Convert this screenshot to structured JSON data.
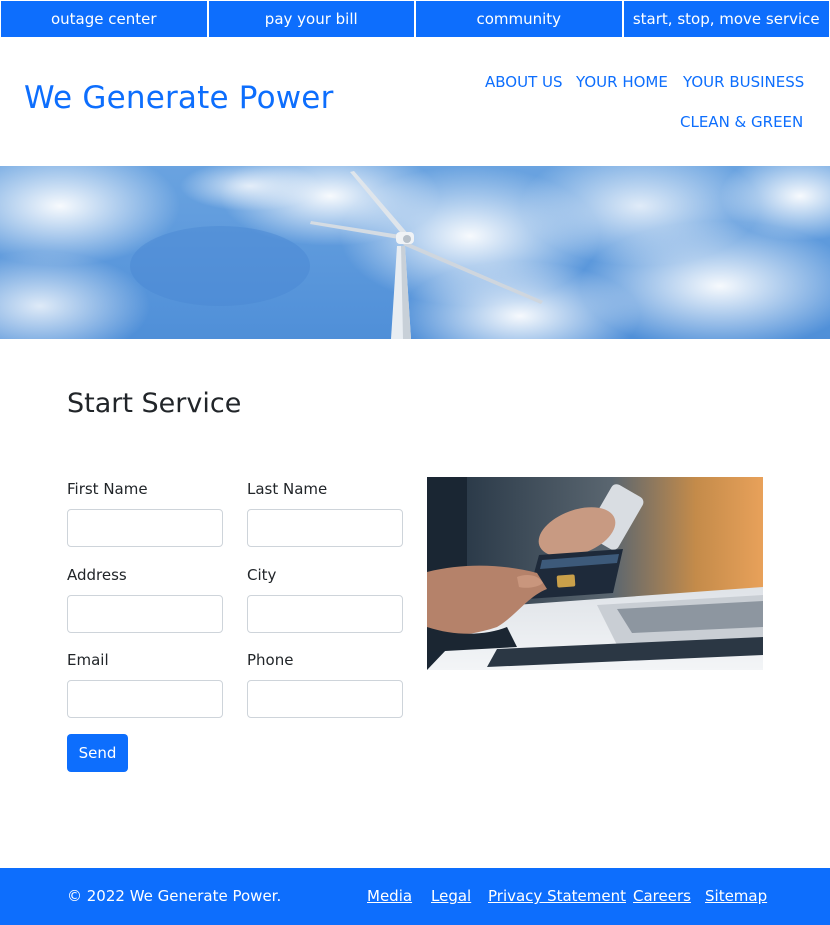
{
  "topbar": {
    "items": [
      {
        "label": "outage center"
      },
      {
        "label": "pay your bill"
      },
      {
        "label": "community"
      },
      {
        "label": "start, stop, move service"
      }
    ]
  },
  "header": {
    "brand": "We Generate Power",
    "nav": [
      {
        "label": "ABOUT US"
      },
      {
        "label": "YOUR HOME"
      },
      {
        "label": "YOUR BUSINESS"
      },
      {
        "label": "CLEAN & GREEN"
      }
    ]
  },
  "main": {
    "title": "Start Service",
    "form": {
      "first_name_label": "First Name",
      "first_name_value": "",
      "last_name_label": "Last Name",
      "last_name_value": "",
      "address_label": "Address",
      "address_value": "",
      "city_label": "City",
      "city_value": "",
      "email_label": "Email",
      "email_value": "",
      "phone_label": "Phone",
      "phone_value": "",
      "submit_label": "Send"
    }
  },
  "footer": {
    "copyright": "© 2022 We Generate Power.",
    "links": [
      {
        "label": "Media"
      },
      {
        "label": "Legal"
      },
      {
        "label": "Privacy Statement"
      },
      {
        "label": "Careers"
      },
      {
        "label": "Sitemap"
      }
    ]
  },
  "colors": {
    "accent": "#0d6efd",
    "text": "#212529",
    "input_border": "#ced4da"
  }
}
